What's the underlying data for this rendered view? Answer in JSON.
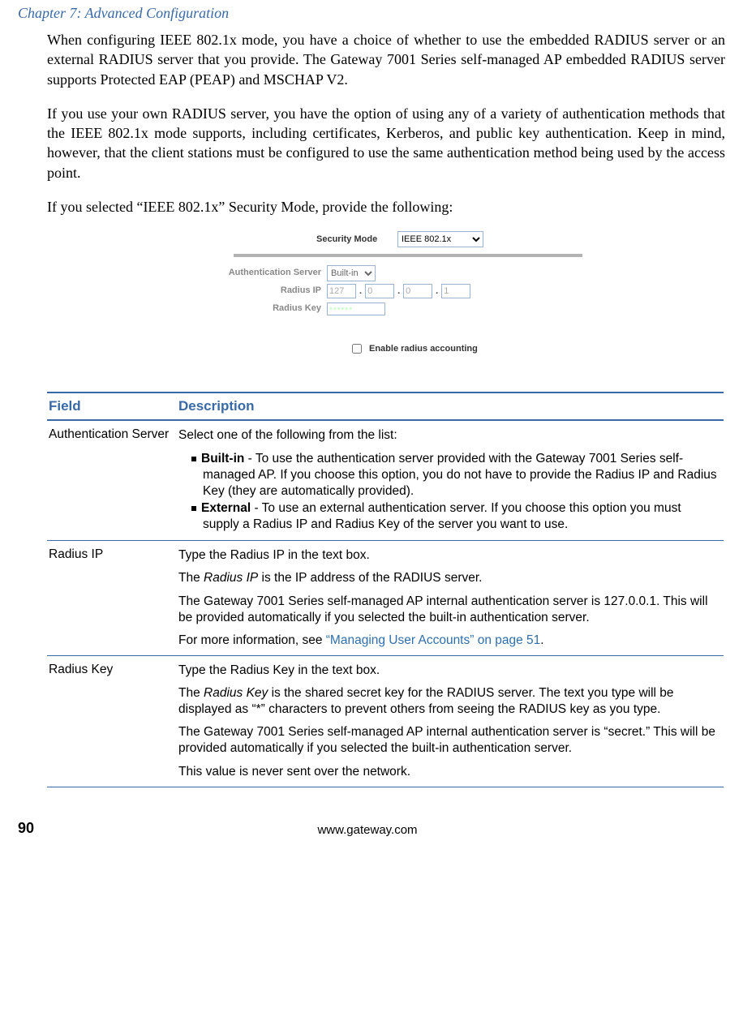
{
  "chapterTitle": "Chapter 7: Advanced Configuration",
  "para1": "When configuring IEEE 802.1x mode, you have a choice of whether to use the embedded RADIUS server or an external RADIUS server that you provide. The Gateway 7001 Series self-managed AP embedded RADIUS server supports Protected EAP (PEAP) and MSCHAP V2.",
  "para2": "If you use your own RADIUS server, you have the option of using any of a variety of authentication methods that the IEEE 802.1x mode supports, including certificates, Kerberos, and public key authentication. Keep in mind, however, that the client stations must be configured to use the same authentication method being used by the access point.",
  "para3": "If you selected “IEEE 802.1x” Security Mode, provide the following:",
  "shot": {
    "securityModeLabel": "Security Mode",
    "securityModeValue": "IEEE 802.1x",
    "authServerLabel": "Authentication Server",
    "authServerValue": "Built-in",
    "radiusIpLabel": "Radius IP",
    "ip1": "127",
    "ip2": "0",
    "ip3": "0",
    "ip4": "1",
    "radiusKeyLabel": "Radius Key",
    "radiusKeyValue": "••••••",
    "enableAccounting": "Enable radius accounting"
  },
  "table": {
    "h1": "Field",
    "h2": "Description",
    "r1f": "Authentication Server",
    "r1p1": "Select one of the following from the list:",
    "r1b1bold": "Built-in",
    "r1b1rest": " - To use the authentication server provided with the Gateway 7001 Series self-managed AP. If you choose this option, you do not have to provide the Radius IP and Radius Key (they are automatically provided).",
    "r1b2bold": "External",
    "r1b2rest": " - To use an external authentication server. If you choose this option you must supply a Radius IP and Radius Key of the server you want to use.",
    "r2f": "Radius IP",
    "r2p1": "Type the Radius IP in the text box.",
    "r2p2a": "The ",
    "r2p2em": "Radius IP",
    "r2p2b": " is the IP address of the RADIUS server.",
    "r2p3": "The Gateway 7001 Series self-managed AP internal authentication server is 127.0.0.1. This will be provided automatically if you selected the built-in authentication server.",
    "r2p4a": "For more information, see ",
    "r2p4link": "“Managing User Accounts” on page 51",
    "r2p4b": ".",
    "r3f": "Radius Key",
    "r3p1": "Type the Radius Key in the text box.",
    "r3p2a": "The ",
    "r3p2em": "Radius Key",
    "r3p2b": " is the shared secret key for the RADIUS server. The text you type will be displayed as “*” characters to prevent others from seeing the RADIUS key as you type.",
    "r3p3": "The Gateway 7001 Series self-managed AP internal authentication server is “secret.” This will be provided automatically if you selected the built-in authentication server.",
    "r3p4": "This value is never sent over the network."
  },
  "pageNumber": "90",
  "siteUrl": "www.gateway.com"
}
